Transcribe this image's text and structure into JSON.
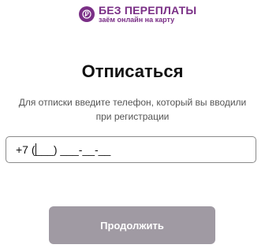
{
  "logo": {
    "badge_icon": "ruble-coin-icon",
    "title": "БЕЗ ПЕРЕПЛАТЫ",
    "subtitle": "заём онлайн на карту",
    "brand_color": "#7a2f86"
  },
  "page": {
    "heading": "Отписаться",
    "description": "Для отписки введите телефон, который вы вводили при регистрации"
  },
  "phone": {
    "prefix": "+7 (",
    "mask_rest": "___) ___-__-__"
  },
  "button": {
    "label": "Продолжить",
    "color": "#a09aa3"
  }
}
